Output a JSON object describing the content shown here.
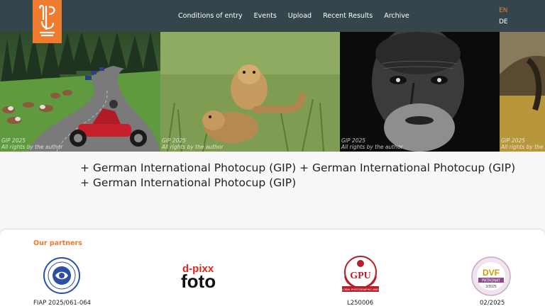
{
  "header": {
    "nav": [
      {
        "label": "Conditions of entry"
      },
      {
        "label": "Events"
      },
      {
        "label": "Upload"
      },
      {
        "label": "Recent Results"
      },
      {
        "label": "Archive"
      }
    ],
    "languages": {
      "en": "EN",
      "de": "DE"
    },
    "colors": {
      "bar": "#34454c",
      "accent": "#ee7b2e"
    }
  },
  "hero": {
    "photos": [
      {
        "caption_line1": "GIP 2025",
        "caption_line2": "All rights by the author"
      },
      {
        "caption_line1": "GIP 2025",
        "caption_line2": "All rights by the author"
      },
      {
        "caption_line1": "GIP 2025",
        "caption_line2": "All rights by the author"
      },
      {
        "caption_line1": "GIP 2025",
        "caption_line2": "All rights by the author"
      }
    ]
  },
  "ticker": {
    "text": "+ German International Photocup (GIP) + German International Photocup (GIP) + German International Photocup (GIP)"
  },
  "partners": {
    "title": "Our partners",
    "items": [
      {
        "label": "FIAP 2025/061-064",
        "logo": "fiap-logo"
      },
      {
        "label": "",
        "logo_text_1": "d-pixx",
        "logo_text_2": "foto",
        "logo": "dpixx-foto-logo"
      },
      {
        "label": "L250006",
        "logo_text": "GPU",
        "logo_subtext": "GLOBAL PHOTOGRAPHIC UNION",
        "logo": "gpu-logo"
      },
      {
        "label": "02/2025",
        "logo_text": "DVF",
        "logo_subtext": "PATRONAT",
        "logo_year": "2/2025",
        "logo": "dvf-logo"
      }
    ]
  }
}
